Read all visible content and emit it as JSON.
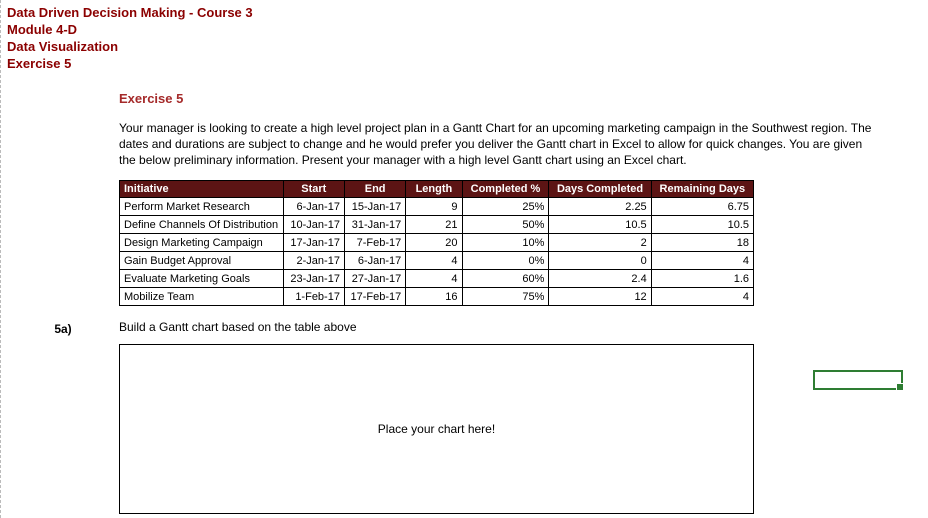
{
  "header": {
    "line1": "Data Driven Decision Making - Course 3",
    "line2": "Module 4-D",
    "line3": "Data Visualization",
    "line4": "Exercise 5"
  },
  "exercise": {
    "title": "Exercise 5",
    "prompt": "Your manager is looking to create a high level project plan in a Gantt Chart for an upcoming marketing campaign in the Southwest region. The dates and durations are subject to change and he would prefer you deliver the Gantt chart in Excel to allow for quick changes. You are given the below preliminary information. Present your manager with a high level Gantt chart using an Excel chart."
  },
  "table": {
    "headers": {
      "c0": "Initiative",
      "c1": "Start",
      "c2": "End",
      "c3": "Length",
      "c4": "Completed %",
      "c5": "Days Completed",
      "c6": "Remaining Days"
    },
    "rows": [
      {
        "c0": "Perform Market Research",
        "c1": "6-Jan-17",
        "c2": "15-Jan-17",
        "c3": "9",
        "c4": "25%",
        "c5": "2.25",
        "c6": "6.75"
      },
      {
        "c0": "Define Channels Of Distribution",
        "c1": "10-Jan-17",
        "c2": "31-Jan-17",
        "c3": "21",
        "c4": "50%",
        "c5": "10.5",
        "c6": "10.5"
      },
      {
        "c0": "Design Marketing Campaign",
        "c1": "17-Jan-17",
        "c2": "7-Feb-17",
        "c3": "20",
        "c4": "10%",
        "c5": "2",
        "c6": "18"
      },
      {
        "c0": "Gain Budget Approval",
        "c1": "2-Jan-17",
        "c2": "6-Jan-17",
        "c3": "4",
        "c4": "0%",
        "c5": "0",
        "c6": "4"
      },
      {
        "c0": "Evaluate Marketing Goals",
        "c1": "23-Jan-17",
        "c2": "27-Jan-17",
        "c3": "4",
        "c4": "60%",
        "c5": "2.4",
        "c6": "1.6"
      },
      {
        "c0": "Mobilize Team",
        "c1": "1-Feb-17",
        "c2": "17-Feb-17",
        "c3": "16",
        "c4": "75%",
        "c5": "12",
        "c6": "4"
      }
    ]
  },
  "question": {
    "label": "5a)",
    "text": "Build a Gantt chart based on the table above",
    "placeholder": "Place your chart here!"
  }
}
